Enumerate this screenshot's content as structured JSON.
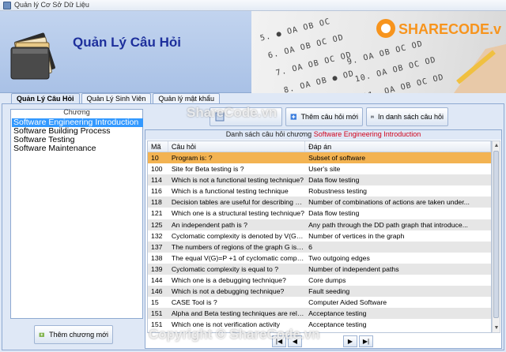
{
  "window": {
    "title": "Quản lý Cơ Sở Dữ Liệu"
  },
  "banner": {
    "title": "Quản Lý Câu Hỏi",
    "brand": "SHARECODE.vn",
    "sheet_rows": [
      "5. ● OA OB OC",
      "6. OA OB OC OD",
      "7. OA OB OC OD",
      "8. OA OB ● OD",
      "9. OA OB OC OD",
      "10. OA OB OC OD",
      "11. OA OB OC OD"
    ]
  },
  "tabs": [
    {
      "label": "Quản Lý Câu Hỏi",
      "active": true
    },
    {
      "label": "Quản Lý Sinh Viên",
      "active": false
    },
    {
      "label": "Quản lý mật khẩu",
      "active": false
    }
  ],
  "chapters": {
    "legend": "Chương",
    "items": [
      {
        "label": "Software Engineering Introduction",
        "selected": true
      },
      {
        "label": "Software Building Process",
        "selected": false
      },
      {
        "label": "Software Testing",
        "selected": false
      },
      {
        "label": "Software Maintenance",
        "selected": false
      }
    ],
    "add_button": "Thêm chương mới"
  },
  "toolbar": {
    "add_question": "Thêm câu hỏi mới",
    "print_list": "In danh sách câu hỏi"
  },
  "table": {
    "title_prefix": "Danh sách câu hỏi chương",
    "title_chapter": "Software Engineering Introduction",
    "columns": [
      "Mã",
      "Câu hỏi",
      "Đáp án"
    ],
    "rows": [
      [
        "10",
        "Program is: ?",
        "Subset of software"
      ],
      [
        "100",
        "Site for Beta testing is ?",
        "User's site"
      ],
      [
        "114",
        "Which is not a functional testing technique?",
        "Data flow testing"
      ],
      [
        "116",
        "Which is a functional testing technique",
        "Robustness testing"
      ],
      [
        "118",
        "Decision tables are useful for describing situations ...",
        "Number of combinations of actions are taken under..."
      ],
      [
        "121",
        "Which one is a structural testing technique?",
        "Data flow testing"
      ],
      [
        "125",
        "An independent path is ?",
        "Any path through the DD path graph that introduce..."
      ],
      [
        "132",
        "Cyclomatic complexity is denoted by V(G)=e-n+2...",
        "Number of vertices in the graph"
      ],
      [
        "137",
        "The numbers of regions of the graph G is 6. The cy...",
        "6"
      ],
      [
        "138",
        "The equal  V(G)=P +1 of cyclomatic complexity is ...",
        "Two outgoing edges"
      ],
      [
        "139",
        "Cyclomatic complexity is equal to ?",
        "Number of independent paths"
      ],
      [
        "144",
        "Which one is a debugging technique?",
        "Core dumps"
      ],
      [
        "146",
        "Which is not a debugging technique?",
        "Fault seeding"
      ],
      [
        "15",
        "CASE Tool is ?",
        "Computer Aided Software"
      ],
      [
        "151",
        "Alpha and Beta testing techniques are related to ?",
        "Acceptance testing"
      ],
      [
        "151",
        "Which one is not verification activity",
        "Acceptance testing"
      ]
    ],
    "selected_row": 0,
    "pager": {
      "prev_all": "|◀",
      "prev": "◀",
      "next": "▶",
      "next_all": "▶|",
      "page_text": ""
    }
  },
  "watermarks": {
    "center": "ShareCode.vn",
    "bottom": "Copyright © ShareCode.vn"
  },
  "colors": {
    "accent": "#1d2f9c",
    "selection": "#3399ff",
    "row_selected": "#f3b352",
    "title_highlight": "#d0021b"
  }
}
